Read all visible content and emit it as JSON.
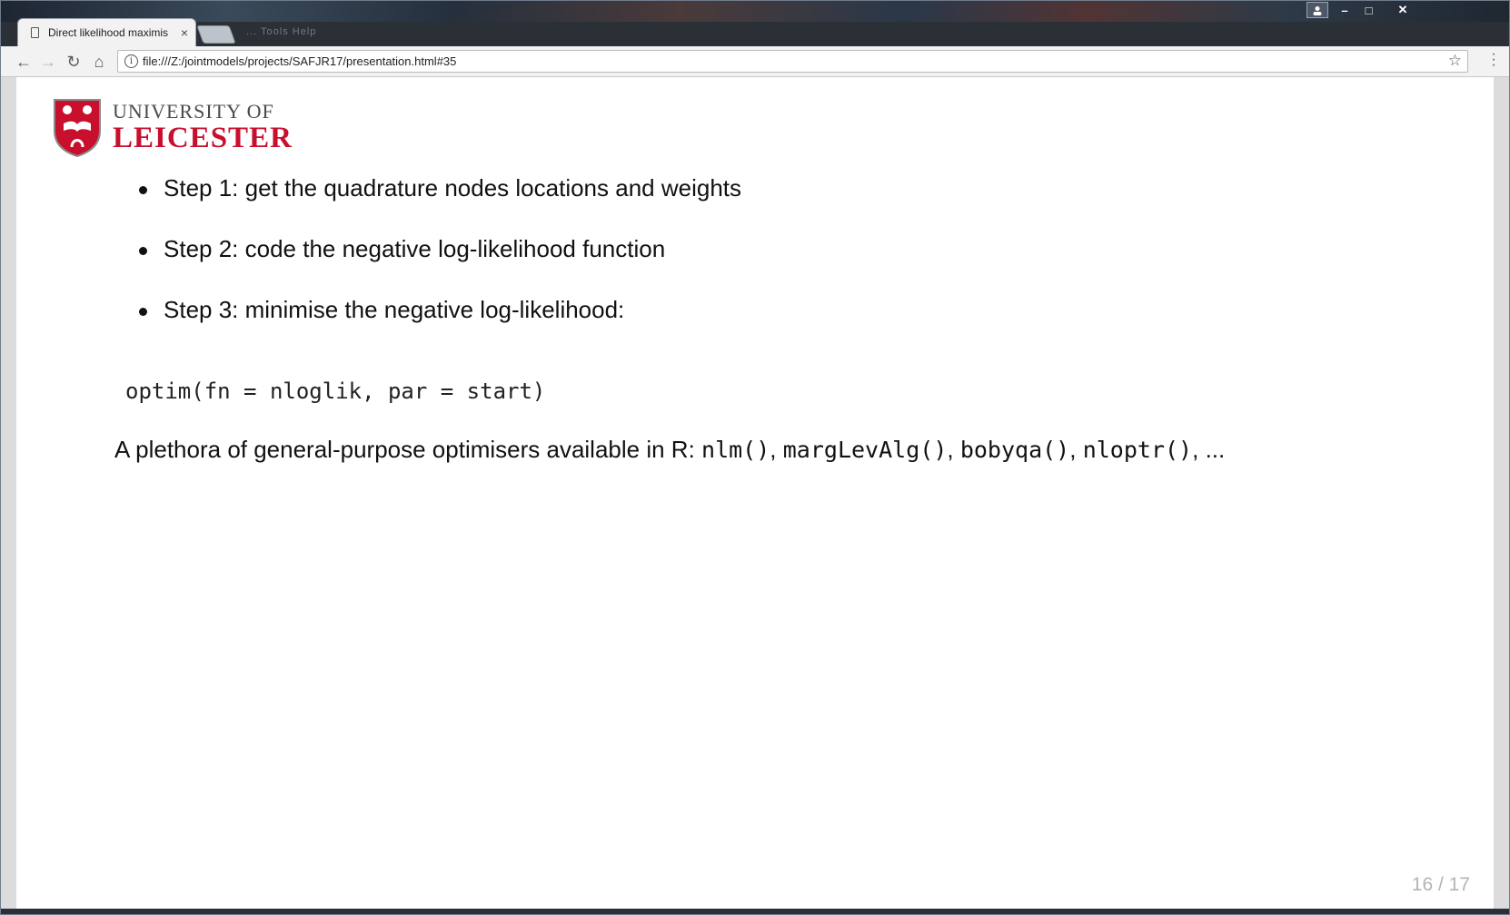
{
  "browser": {
    "tab_title": "Direct likelihood maximis",
    "tab_close": "×",
    "ghost_menu": "...   Tools   Help",
    "url": "file:///Z:/jointmodels/projects/SAFJR17/presentation.html#35",
    "window_controls": {
      "minimize": "–",
      "maximize": "□",
      "close": "✕"
    },
    "nav": {
      "back": "←",
      "forward": "→",
      "reload": "↻",
      "home": "⌂",
      "info": "i",
      "star": "☆"
    }
  },
  "logo": {
    "line1": "UNIVERSITY OF",
    "line2": "LEICESTER",
    "shield_color": "#c8102e"
  },
  "slide": {
    "bullets": [
      "Step 1: get the quadrature nodes locations and weights",
      "Step 2: code the negative log-likelihood function",
      "Step 3: minimise the negative log-likelihood:"
    ],
    "code": "optim(fn = nloglik, par = start)",
    "paragraph_prefix": "A plethora of general-purpose optimisers available in R: ",
    "optimisers": [
      "nlm()",
      "margLevAlg()",
      "bobyqa()",
      "nloptr()"
    ],
    "separator": ", ",
    "paragraph_suffix": ", ...",
    "counter": "16 / 17"
  }
}
